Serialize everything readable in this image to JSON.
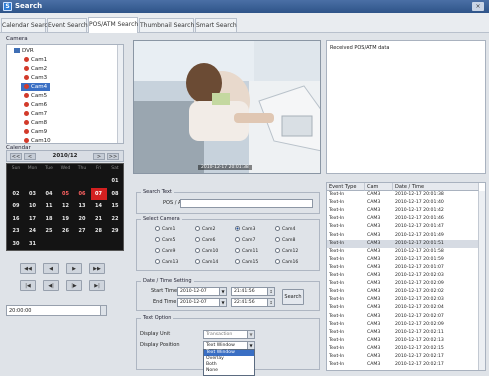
{
  "window": {
    "title": "Search",
    "close_label": "×",
    "logo_label": "S"
  },
  "tabs": [
    "Calendar Search",
    "Event Search",
    "POS/ATM Search",
    "Thumbnail Search",
    "Smart Search"
  ],
  "camera_panel": {
    "label": "Camera",
    "root": "DVR",
    "items": [
      "Cam1",
      "Cam2",
      "Cam3",
      "Cam4",
      "Cam5",
      "Cam6",
      "Cam7",
      "Cam8",
      "Cam9",
      "Cam10"
    ],
    "selected": "Cam4"
  },
  "calendar": {
    "label": "Calendar",
    "prev_year": "<<",
    "prev_month": "<",
    "month": "2010/12",
    "next_month": ">",
    "next_year": ">>",
    "day_names": [
      "Sun",
      "Mon",
      "Tue",
      "Wed",
      "Thu",
      "Fri",
      "Sat"
    ],
    "weeks": [
      [
        "",
        "",
        "",
        "",
        "",
        "",
        "01"
      ],
      [
        "02",
        "03",
        "04",
        "05",
        "06",
        "07",
        "08"
      ],
      [
        "09",
        "10",
        "11",
        "12",
        "13",
        "14",
        "15"
      ],
      [
        "16",
        "17",
        "18",
        "19",
        "20",
        "21",
        "22"
      ],
      [
        "23",
        "24",
        "25",
        "26",
        "27",
        "28",
        "29"
      ],
      [
        "30",
        "31",
        "",
        "",
        "",
        "",
        ""
      ]
    ],
    "recorded_days": [
      "05",
      "06"
    ],
    "today": "07"
  },
  "playback": {
    "row1": [
      "◀◀",
      "◀",
      "▶",
      "▶▶"
    ],
    "row2": [
      "|◀",
      "◀|",
      "|▶",
      "▶|"
    ]
  },
  "time_field": {
    "value": "20:00:00"
  },
  "video": {
    "timestamp": "2010-12-17 20:01:38"
  },
  "text_list": {
    "item": "Received POS/ATM data"
  },
  "search_text": {
    "legend": "Search Text",
    "label": "POS / ATM",
    "value": ""
  },
  "select_camera": {
    "legend": "Select Camera",
    "cameras": [
      "Cam1",
      "Cam2",
      "Cam3",
      "Cam4",
      "Cam5",
      "Cam6",
      "Cam7",
      "Cam8",
      "Cam9",
      "Cam10",
      "Cam11",
      "Cam12",
      "Cam13",
      "Cam14",
      "Cam15",
      "Cam16"
    ],
    "selected": "Cam3"
  },
  "date_time": {
    "legend": "Date / Time Setting",
    "start_label": "Start Time",
    "start_date": "2010-12-07",
    "start_time": "21:41:56",
    "end_label": "End Time",
    "end_date": "2010-12-07",
    "end_time": "22:41:56",
    "search_button": "Search"
  },
  "text_option": {
    "legend": "Text Option",
    "display_unit_label": "Display Unit",
    "display_unit_value": "Transaction",
    "display_position_label": "Display Position",
    "display_position_value": "Text Window",
    "options": [
      "Text Window",
      "Overlay",
      "Both",
      "None"
    ],
    "selected_option": "Text Window"
  },
  "events": {
    "headers": [
      "Event Type",
      "Cam",
      "Date / Time"
    ],
    "rows": [
      [
        "Text-In",
        "CAM3",
        "2010-12-17 20:01:38"
      ],
      [
        "Text-In",
        "CAM3",
        "2010-12-17 20:01:40"
      ],
      [
        "Text-In",
        "CAM3",
        "2010-12-17 20:01:42"
      ],
      [
        "Text-In",
        "CAM3",
        "2010-12-17 20:01:46"
      ],
      [
        "Text-In",
        "CAM3",
        "2010-12-17 20:01:47"
      ],
      [
        "Text-In",
        "CAM3",
        "2010-12-17 20:01:49"
      ],
      [
        "Text-In",
        "CAM3",
        "2010-12-17 20:01:51"
      ],
      [
        "Text-In",
        "CAM3",
        "2010-12-17 20:01:58"
      ],
      [
        "Text-In",
        "CAM3",
        "2010-12-17 20:01:59"
      ],
      [
        "Text-In",
        "CAM3",
        "2010-12-17 20:01:07"
      ],
      [
        "Text-In",
        "CAM3",
        "2010-12-17 20:02:03"
      ],
      [
        "Text-In",
        "CAM3",
        "2010-12-17 20:02:09"
      ],
      [
        "Text-In",
        "CAM3",
        "2010-12-17 20:02:02"
      ],
      [
        "Text-In",
        "CAM3",
        "2010-12-17 20:02:03"
      ],
      [
        "Text-In",
        "CAM3",
        "2010-12-17 20:02:04"
      ],
      [
        "Text-In",
        "CAM3",
        "2010-12-17 20:02:07"
      ],
      [
        "Text-In",
        "CAM3",
        "2010-12-17 20:02:09"
      ],
      [
        "Text-In",
        "CAM3",
        "2010-12-17 20:02:11"
      ],
      [
        "Text-In",
        "CAM3",
        "2010-12-17 20:02:13"
      ],
      [
        "Text-In",
        "CAM3",
        "2010-12-17 20:02:15"
      ],
      [
        "Text-In",
        "CAM3",
        "2010-12-17 20:02:17"
      ],
      [
        "Text-In",
        "CAM3",
        "2010-12-17 20:02:17"
      ]
    ],
    "selected_row": 6
  },
  "colors": {
    "accent": "#3a6fc4",
    "today": "#d32020",
    "recorded": "#ff6262",
    "titlebar": "#2f5489"
  }
}
